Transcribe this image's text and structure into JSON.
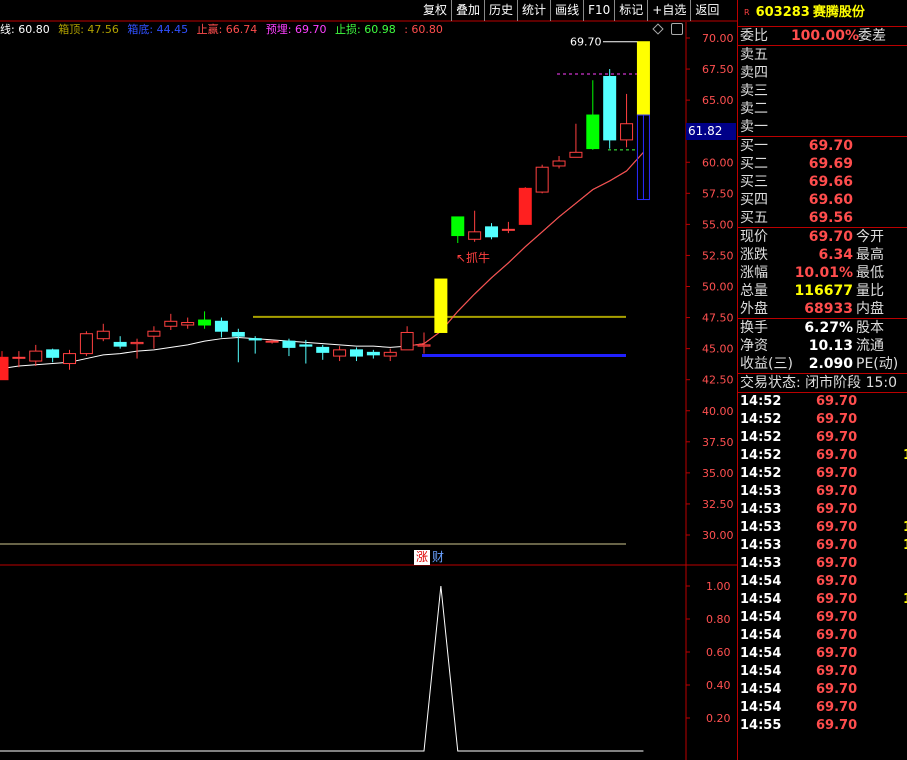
{
  "toolbar": {
    "buttons": [
      "复权",
      "叠加",
      "历史",
      "统计",
      "画线",
      "F10",
      "标记",
      "+自选",
      "返回"
    ]
  },
  "title_row": {
    "period_label": "线: 60.80",
    "box_top": "箱顶: 47.56",
    "box_bottom": "箱底: 44.45",
    "take_profit": "止赢: 66.74",
    "expected": "预埋: 69.70",
    "stop_loss": "止损: 60.98",
    "extra": ": 60.80"
  },
  "chart_data": {
    "type": "candlestick",
    "y_ticks": [
      "70.00",
      "67.50",
      "65.00",
      "62.50",
      "60.00",
      "57.50",
      "55.00",
      "52.50",
      "50.00",
      "47.50",
      "45.00",
      "42.50",
      "40.00",
      "37.50",
      "35.00",
      "32.50",
      "30.00"
    ],
    "ylim": [
      28.5,
      71
    ],
    "max_label": "69.70",
    "current_price_label": "61.82",
    "annotation": "↖抓牛",
    "box_top_value": 47.56,
    "box_bottom_value": 44.45,
    "candles": [
      {
        "o": 42.5,
        "h": 44.8,
        "l": 42.5,
        "c": 44.3
      },
      {
        "o": 44.3,
        "h": 44.8,
        "l": 43.5,
        "c": 44.3
      },
      {
        "o": 44.0,
        "h": 45.3,
        "l": 43.6,
        "c": 44.8
      },
      {
        "o": 44.9,
        "h": 45.0,
        "l": 43.9,
        "c": 44.3
      },
      {
        "o": 43.8,
        "h": 44.9,
        "l": 43.3,
        "c": 44.6
      },
      {
        "o": 44.6,
        "h": 46.4,
        "l": 44.4,
        "c": 46.2
      },
      {
        "o": 45.8,
        "h": 47.0,
        "l": 45.6,
        "c": 46.4
      },
      {
        "o": 45.5,
        "h": 46.0,
        "l": 45.0,
        "c": 45.2
      },
      {
        "o": 45.4,
        "h": 45.8,
        "l": 44.2,
        "c": 45.5
      },
      {
        "o": 46.0,
        "h": 46.8,
        "l": 45.0,
        "c": 46.4
      },
      {
        "o": 46.8,
        "h": 47.8,
        "l": 46.5,
        "c": 47.2
      },
      {
        "o": 46.9,
        "h": 47.5,
        "l": 46.6,
        "c": 47.1
      },
      {
        "o": 46.9,
        "h": 48.0,
        "l": 46.6,
        "c": 47.3
      },
      {
        "o": 47.2,
        "h": 47.5,
        "l": 45.9,
        "c": 46.4
      },
      {
        "o": 46.3,
        "h": 46.6,
        "l": 43.9,
        "c": 46.0
      },
      {
        "o": 45.8,
        "h": 46.0,
        "l": 44.6,
        "c": 45.7
      },
      {
        "o": 45.6,
        "h": 45.7,
        "l": 45.4,
        "c": 45.6
      },
      {
        "o": 45.6,
        "h": 45.8,
        "l": 44.4,
        "c": 45.1
      },
      {
        "o": 45.3,
        "h": 45.7,
        "l": 43.8,
        "c": 45.2
      },
      {
        "o": 45.1,
        "h": 45.3,
        "l": 44.1,
        "c": 44.7
      },
      {
        "o": 44.4,
        "h": 45.2,
        "l": 44.0,
        "c": 44.9
      },
      {
        "o": 44.9,
        "h": 45.1,
        "l": 44.0,
        "c": 44.4
      },
      {
        "o": 44.7,
        "h": 44.9,
        "l": 44.2,
        "c": 44.5
      },
      {
        "o": 44.4,
        "h": 45.0,
        "l": 44.0,
        "c": 44.7
      },
      {
        "o": 44.9,
        "h": 46.8,
        "l": 44.9,
        "c": 46.3
      },
      {
        "o": 45.2,
        "h": 46.3,
        "l": 44.6,
        "c": 45.3
      },
      {
        "o": 46.3,
        "h": 50.6,
        "l": 46.3,
        "c": 50.6
      },
      {
        "o": 55.6,
        "h": 55.6,
        "l": 53.5,
        "c": 54.1
      },
      {
        "o": 53.8,
        "h": 56.1,
        "l": 53.6,
        "c": 54.4
      },
      {
        "o": 54.8,
        "h": 55.1,
        "l": 53.8,
        "c": 54.0
      },
      {
        "o": 54.6,
        "h": 55.2,
        "l": 54.3,
        "c": 54.6
      },
      {
        "o": 55.0,
        "h": 58.0,
        "l": 55.0,
        "c": 57.9
      },
      {
        "o": 57.6,
        "h": 59.8,
        "l": 57.5,
        "c": 59.6
      },
      {
        "o": 59.7,
        "h": 60.5,
        "l": 59.5,
        "c": 60.1
      },
      {
        "o": 60.4,
        "h": 63.1,
        "l": 60.4,
        "c": 60.8
      },
      {
        "o": 61.1,
        "h": 66.6,
        "l": 61.0,
        "c": 63.8
      },
      {
        "o": 66.9,
        "h": 67.5,
        "l": 61.1,
        "c": 61.8
      },
      {
        "o": 61.8,
        "h": 65.5,
        "l": 61.2,
        "c": 63.1
      },
      {
        "o": 63.8,
        "h": 69.7,
        "l": 57.0,
        "c": 69.7
      }
    ],
    "ma": [
      43.4,
      43.6,
      43.7,
      43.8,
      43.9,
      44.2,
      44.5,
      44.6,
      44.8,
      44.9,
      45.1,
      45.3,
      45.6,
      45.8,
      45.9,
      45.8,
      45.7,
      45.6,
      45.5,
      45.4,
      45.3,
      45.2,
      45.2,
      45.1,
      45.2,
      45.4,
      46.4,
      48.0,
      49.4,
      50.7,
      51.9,
      53.2,
      54.4,
      55.6,
      56.7,
      57.8,
      58.5,
      59.3,
      60.8
    ],
    "indicator": {
      "tabs": [
        "涨",
        "财"
      ],
      "y_ticks": [
        "1.00",
        "0.80",
        "0.60",
        "0.40",
        "0.20"
      ],
      "ylim": [
        0,
        1.05
      ],
      "values": [
        0,
        0,
        0,
        0,
        0,
        0,
        0,
        0,
        0,
        0,
        0,
        0,
        0,
        0,
        0,
        0,
        0,
        0,
        0,
        0,
        0,
        0,
        0,
        0,
        0,
        0,
        1,
        0,
        0,
        0,
        0,
        0,
        0,
        0,
        0,
        0,
        0,
        0,
        0
      ]
    }
  },
  "panel": {
    "code": "603283",
    "name": "赛腾股份",
    "r_mark": "R",
    "weibi_label": "委比",
    "weibi_value": "100.00%",
    "weicha_label": "委差",
    "sells": [
      "卖五",
      "卖四",
      "卖三",
      "卖二",
      "卖一"
    ],
    "buys": [
      {
        "label": "买一",
        "price": "69.70"
      },
      {
        "label": "买二",
        "price": "69.69"
      },
      {
        "label": "买三",
        "price": "69.66"
      },
      {
        "label": "买四",
        "price": "69.60"
      },
      {
        "label": "买五",
        "price": "69.56"
      }
    ],
    "quote": [
      {
        "l1": "现价",
        "v": "69.70",
        "l2": "今开",
        "cls": "red"
      },
      {
        "l1": "涨跌",
        "v": "6.34",
        "l2": "最高",
        "cls": "red"
      },
      {
        "l1": "涨幅",
        "v": "10.01%",
        "l2": "最低",
        "cls": "red"
      },
      {
        "l1": "总量",
        "v": "116677",
        "l2": "量比",
        "cls": "yellow"
      },
      {
        "l1": "外盘",
        "v": "68933",
        "l2": "内盘",
        "cls": "red"
      }
    ],
    "fundamentals": [
      {
        "l1": "换手",
        "v": "6.27%",
        "l2": "股本"
      },
      {
        "l1": "净资",
        "v": "10.13",
        "l2": "流通"
      },
      {
        "l1": "收益(三)",
        "v": "2.090",
        "l2": "PE(动)"
      }
    ],
    "trade_status": "交易状态: 闭市阶段 15:0",
    "ticks": [
      {
        "t": "14:52",
        "p": "69.70",
        "v": ""
      },
      {
        "t": "14:52",
        "p": "69.70",
        "v": ""
      },
      {
        "t": "14:52",
        "p": "69.70",
        "v": ""
      },
      {
        "t": "14:52",
        "p": "69.70",
        "v": "1"
      },
      {
        "t": "14:52",
        "p": "69.70",
        "v": ""
      },
      {
        "t": "14:53",
        "p": "69.70",
        "v": ""
      },
      {
        "t": "14:53",
        "p": "69.70",
        "v": ""
      },
      {
        "t": "14:53",
        "p": "69.70",
        "v": "1"
      },
      {
        "t": "14:53",
        "p": "69.70",
        "v": "1"
      },
      {
        "t": "14:53",
        "p": "69.70",
        "v": ""
      },
      {
        "t": "14:54",
        "p": "69.70",
        "v": ""
      },
      {
        "t": "14:54",
        "p": "69.70",
        "v": "1"
      },
      {
        "t": "14:54",
        "p": "69.70",
        "v": ""
      },
      {
        "t": "14:54",
        "p": "69.70",
        "v": ""
      },
      {
        "t": "14:54",
        "p": "69.70",
        "v": ""
      },
      {
        "t": "14:54",
        "p": "69.70",
        "v": ""
      },
      {
        "t": "14:54",
        "p": "69.70",
        "v": ""
      },
      {
        "t": "14:54",
        "p": "69.70",
        "v": ""
      },
      {
        "t": "14:55",
        "p": "69.70",
        "v": ""
      }
    ]
  }
}
